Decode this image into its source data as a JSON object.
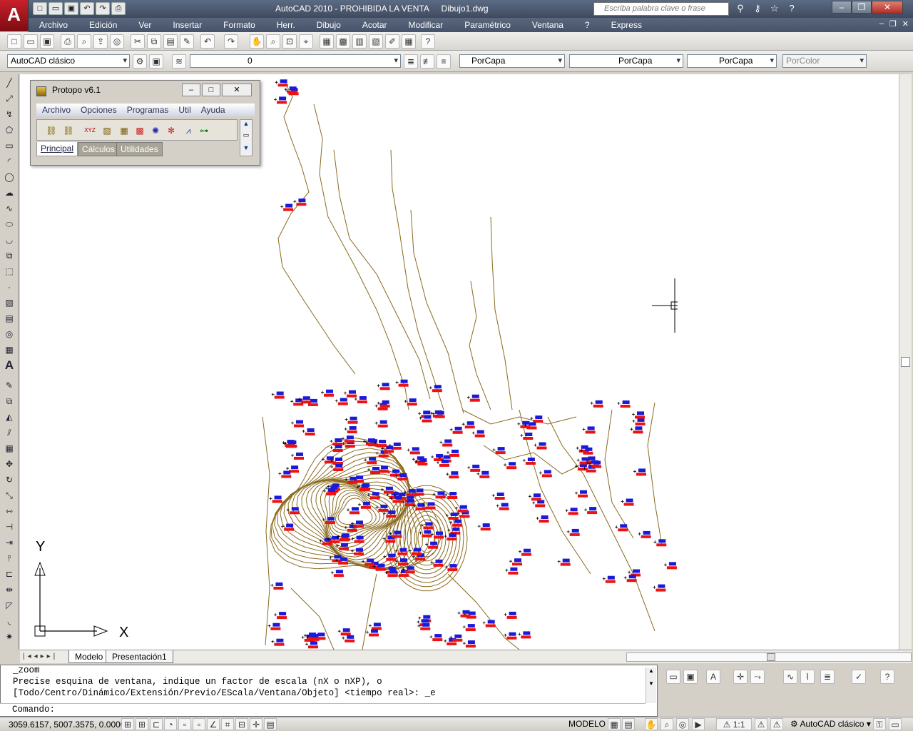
{
  "app": {
    "title": "AutoCAD 2010 - PROHIBIDA LA VENTA",
    "document": "Dibujo1.dwg",
    "logo_letter": "A",
    "search_placeholder": "Escriba palabra clave o frase"
  },
  "menu": [
    "Archivo",
    "Edición",
    "Ver",
    "Insertar",
    "Formato",
    "Herr.",
    "Dibujo",
    "Acotar",
    "Modificar",
    "Paramétrico",
    "Ventana",
    "?",
    "Express"
  ],
  "properties_bar": {
    "workspace": "AutoCAD clásico",
    "layer": "0",
    "color": "PorCapa",
    "linetype": "PorCapa",
    "lineweight": "PorCapa",
    "plotstyle": "PorColor"
  },
  "protopo": {
    "title": "Protopo v6.1",
    "menu": [
      "Archivo",
      "Opciones",
      "Programas",
      "Util",
      "Ayuda"
    ],
    "tabs": [
      "Principal",
      "Cálculos",
      "Utilidades"
    ],
    "tool_glyph": "XYZ"
  },
  "ucs": {
    "y_label": "Y",
    "x_label": "X"
  },
  "tabs": [
    "Modelo",
    "Presentación1"
  ],
  "command": {
    "lines": [
      "_zoom",
      "Precise esquina de ventana, indique un factor de escala (nX o nXP), o",
      "[Todo/Centro/Dinámico/Extensión/Previo/EScala/Ventana/Objeto] <tiempo real>: _e"
    ],
    "prompt": "Comando:"
  },
  "status": {
    "coords": "3059.6157, 5007.3575, 0.0000",
    "mode": "MODELO",
    "annotation_scale": "1:1",
    "workspace": "AutoCAD clásico"
  },
  "colors": {
    "contour": "#8a6a1e",
    "point_label": "#ee1111",
    "point_marker": "#1a1ad8",
    "titlebar": "#4d5a70"
  }
}
